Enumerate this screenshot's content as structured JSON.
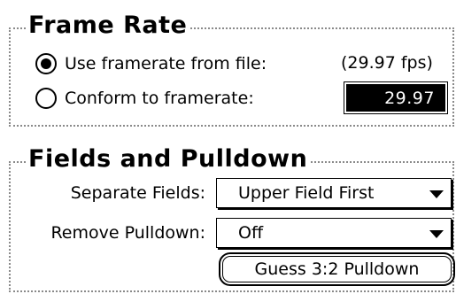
{
  "frame_rate": {
    "title": "Frame Rate",
    "use_file": {
      "label": "Use framerate from file:",
      "selected": true
    },
    "file_fps_note": "(29.97 fps)",
    "conform": {
      "label": "Conform to framerate:",
      "selected": false
    },
    "conform_value": "29.97"
  },
  "fields": {
    "title": "Fields and Pulldown",
    "separate_fields": {
      "label": "Separate Fields:",
      "value": "Upper Field First"
    },
    "remove_pulldown": {
      "label": "Remove Pulldown:",
      "value": "Off"
    },
    "guess_button": "Guess 3:2 Pulldown"
  }
}
